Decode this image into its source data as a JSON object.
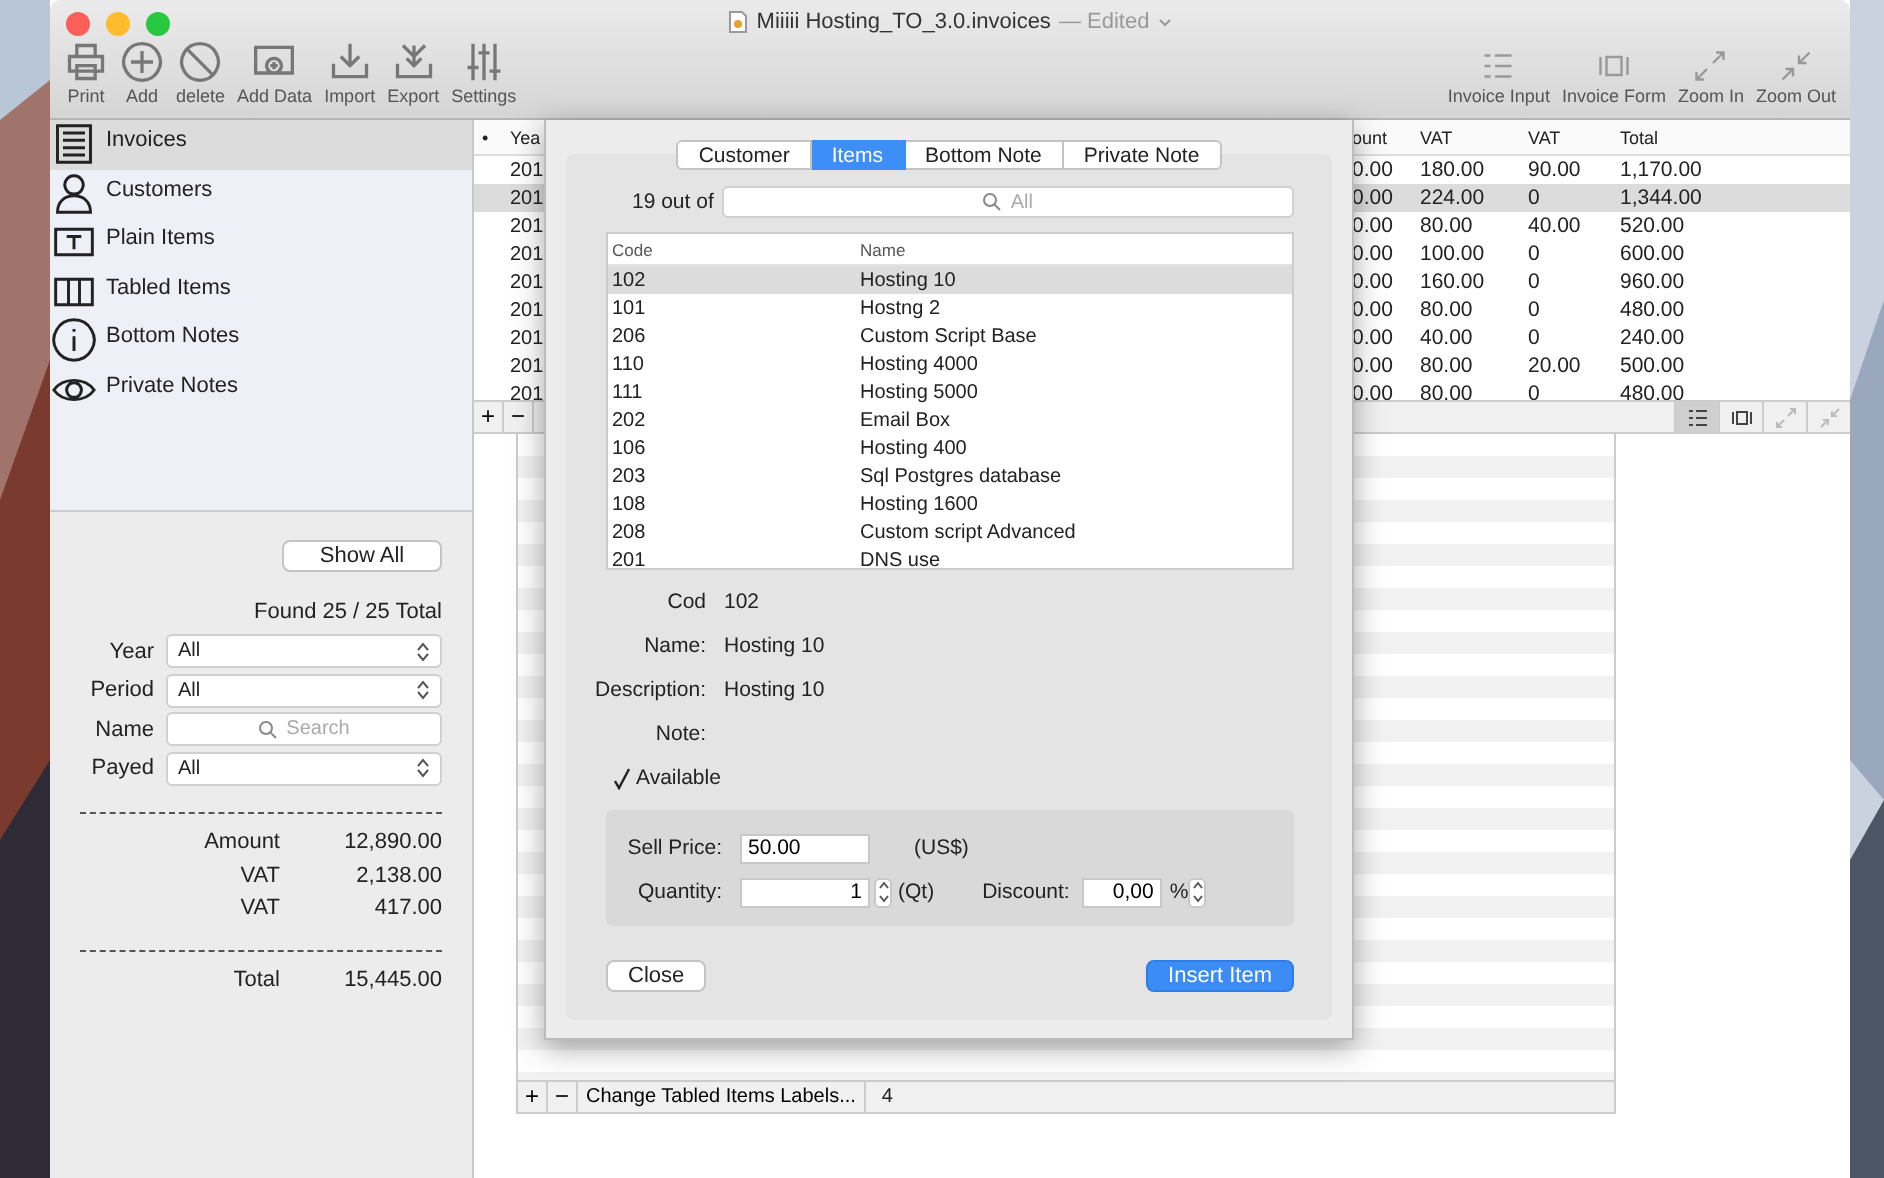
{
  "window": {
    "title": "Miiiii Hosting_TO_3.0.invoices",
    "status": "— Edited"
  },
  "toolbar": {
    "left": [
      {
        "label": "Print"
      },
      {
        "label": "Add"
      },
      {
        "label": "delete"
      },
      {
        "label": "Add Data"
      },
      {
        "label": "Import"
      },
      {
        "label": "Export"
      },
      {
        "label": "Settings"
      }
    ],
    "right": [
      {
        "label": "Invoice Input"
      },
      {
        "label": "Invoice Form"
      },
      {
        "label": "Zoom In"
      },
      {
        "label": "Zoom Out"
      }
    ]
  },
  "sidebar": {
    "items": [
      {
        "label": "Invoices",
        "selected": true
      },
      {
        "label": "Customers",
        "selected": false
      },
      {
        "label": "Plain Items",
        "selected": false
      },
      {
        "label": "Tabled Items",
        "selected": false
      },
      {
        "label": "Bottom Notes",
        "selected": false
      },
      {
        "label": "Private Notes",
        "selected": false
      }
    ]
  },
  "filters": {
    "show_all": "Show All",
    "found": "Found 25 / 25 Total",
    "fields": [
      {
        "label": "Year",
        "kind": "select",
        "value": "All"
      },
      {
        "label": "Period",
        "kind": "select",
        "value": "All"
      },
      {
        "label": "Name",
        "kind": "search",
        "placeholder": "Search"
      },
      {
        "label": "Payed",
        "kind": "select",
        "value": "All"
      }
    ]
  },
  "totals": [
    {
      "label": "Amount",
      "value": "12,890.00"
    },
    {
      "label": "VAT",
      "value": "2,138.00"
    },
    {
      "label": "VAT",
      "value": "417.00"
    }
  ],
  "grand_total": {
    "label": "Total",
    "value": "15,445.00"
  },
  "invoices_table": {
    "sort_marker": "•",
    "columns": [
      "Yea",
      "ount",
      "VAT",
      "VAT",
      "Total"
    ],
    "rows": [
      {
        "cells": [
          "201",
          "0.00",
          "180.00",
          "90.00",
          "1,170.00"
        ],
        "selected": false
      },
      {
        "cells": [
          "201",
          "0.00",
          "224.00",
          "0",
          "1,344.00"
        ],
        "selected": true
      },
      {
        "cells": [
          "201",
          "0.00",
          "80.00",
          "40.00",
          "520.00"
        ],
        "selected": false
      },
      {
        "cells": [
          "201",
          "0.00",
          "100.00",
          "0",
          "600.00"
        ],
        "selected": false
      },
      {
        "cells": [
          "201",
          "0.00",
          "160.00",
          "0",
          "960.00"
        ],
        "selected": false
      },
      {
        "cells": [
          "201",
          "0.00",
          "80.00",
          "0",
          "480.00"
        ],
        "selected": false
      },
      {
        "cells": [
          "201",
          "0.00",
          "40.00",
          "0",
          "240.00"
        ],
        "selected": false
      },
      {
        "cells": [
          "201",
          "0.00",
          "80.00",
          "20.00",
          "500.00"
        ],
        "selected": false
      },
      {
        "cells": [
          "201",
          "0.00",
          "80.00",
          "0",
          "480.00"
        ],
        "selected": false
      }
    ],
    "footer": {
      "add": "+",
      "remove": "−"
    }
  },
  "tabled_items": {
    "footer": {
      "add": "+",
      "remove": "−",
      "labels_button": "Change Tabled Items Labels...",
      "count": "4"
    }
  },
  "dialog": {
    "tabs": [
      {
        "label": "Customer",
        "selected": false
      },
      {
        "label": "Items",
        "selected": true
      },
      {
        "label": "Bottom Note",
        "selected": false
      },
      {
        "label": "Private Note",
        "selected": false
      }
    ],
    "count_label": "19 out of",
    "search_placeholder": "All",
    "columns": [
      "Code",
      "Name"
    ],
    "rows": [
      {
        "code": "102",
        "name": "Hosting 10",
        "selected": true
      },
      {
        "code": "101",
        "name": "Hostng 2",
        "selected": false
      },
      {
        "code": "206",
        "name": "Custom Script Base",
        "selected": false
      },
      {
        "code": "110",
        "name": "Hosting 4000",
        "selected": false
      },
      {
        "code": "111",
        "name": "Hosting 5000",
        "selected": false
      },
      {
        "code": "202",
        "name": "Email Box",
        "selected": false
      },
      {
        "code": "106",
        "name": "Hosting 400",
        "selected": false
      },
      {
        "code": "203",
        "name": "Sql Postgres database",
        "selected": false
      },
      {
        "code": "108",
        "name": "Hosting 1600",
        "selected": false
      },
      {
        "code": "208",
        "name": "Custom script Advanced",
        "selected": false
      },
      {
        "code": "201",
        "name": "DNS use",
        "selected": false
      }
    ],
    "details": [
      {
        "label": "Cod",
        "value": "102"
      },
      {
        "label": "Name:",
        "value": "Hosting 10"
      },
      {
        "label": "Description:",
        "value": "Hosting 10"
      },
      {
        "label": "Note:"
      }
    ],
    "available": {
      "label": "Available",
      "checked": true
    },
    "sell_price": {
      "label": "Sell Price:",
      "value": "50.00",
      "unit": "(US$)"
    },
    "quantity": {
      "label": "Quantity:",
      "value": "1",
      "unit": "(Qt)"
    },
    "discount": {
      "label": "Discount:",
      "value": "0,00",
      "unit": "%"
    },
    "close": "Close",
    "insert": "Insert Item"
  }
}
